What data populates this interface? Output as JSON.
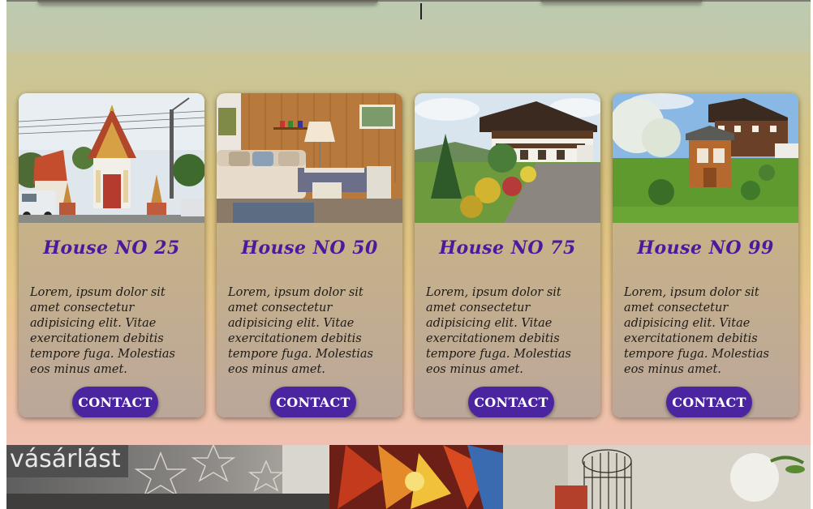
{
  "houses": [
    {
      "title": "House NO 25",
      "description": "Lorem, ipsum dolor sit amet consectetur adipisicing elit. Vitae exercitationem debitis tempore fuga. Molestias eos minus amet.",
      "button": "CONTACT",
      "image_icon": "temple-photo"
    },
    {
      "title": "House NO 50",
      "description": "Lorem, ipsum dolor sit amet consectetur adipisicing elit. Vitae exercitationem debitis tempore fuga. Molestias eos minus amet.",
      "button": "CONTACT",
      "image_icon": "living-room-photo"
    },
    {
      "title": "House NO 75",
      "description": "Lorem, ipsum dolor sit amet consectetur adipisicing elit. Vitae exercitationem debitis tempore fuga. Molestias eos minus amet.",
      "button": "CONTACT",
      "image_icon": "chalet-house-photo"
    },
    {
      "title": "House NO 99",
      "description": "Lorem, ipsum dolor sit amet consectetur adipisicing elit. Vitae exercitationem debitis tempore fuga. Molestias eos minus amet.",
      "button": "CONTACT",
      "image_icon": "garden-house-photo"
    }
  ],
  "bottom_banner": {
    "shop_text": "vásárlást"
  },
  "colors": {
    "title": "#4b1a9c",
    "button": "#4b24a0",
    "section_top": "#c9c69a",
    "section_bottom": "#f0c0b2"
  }
}
